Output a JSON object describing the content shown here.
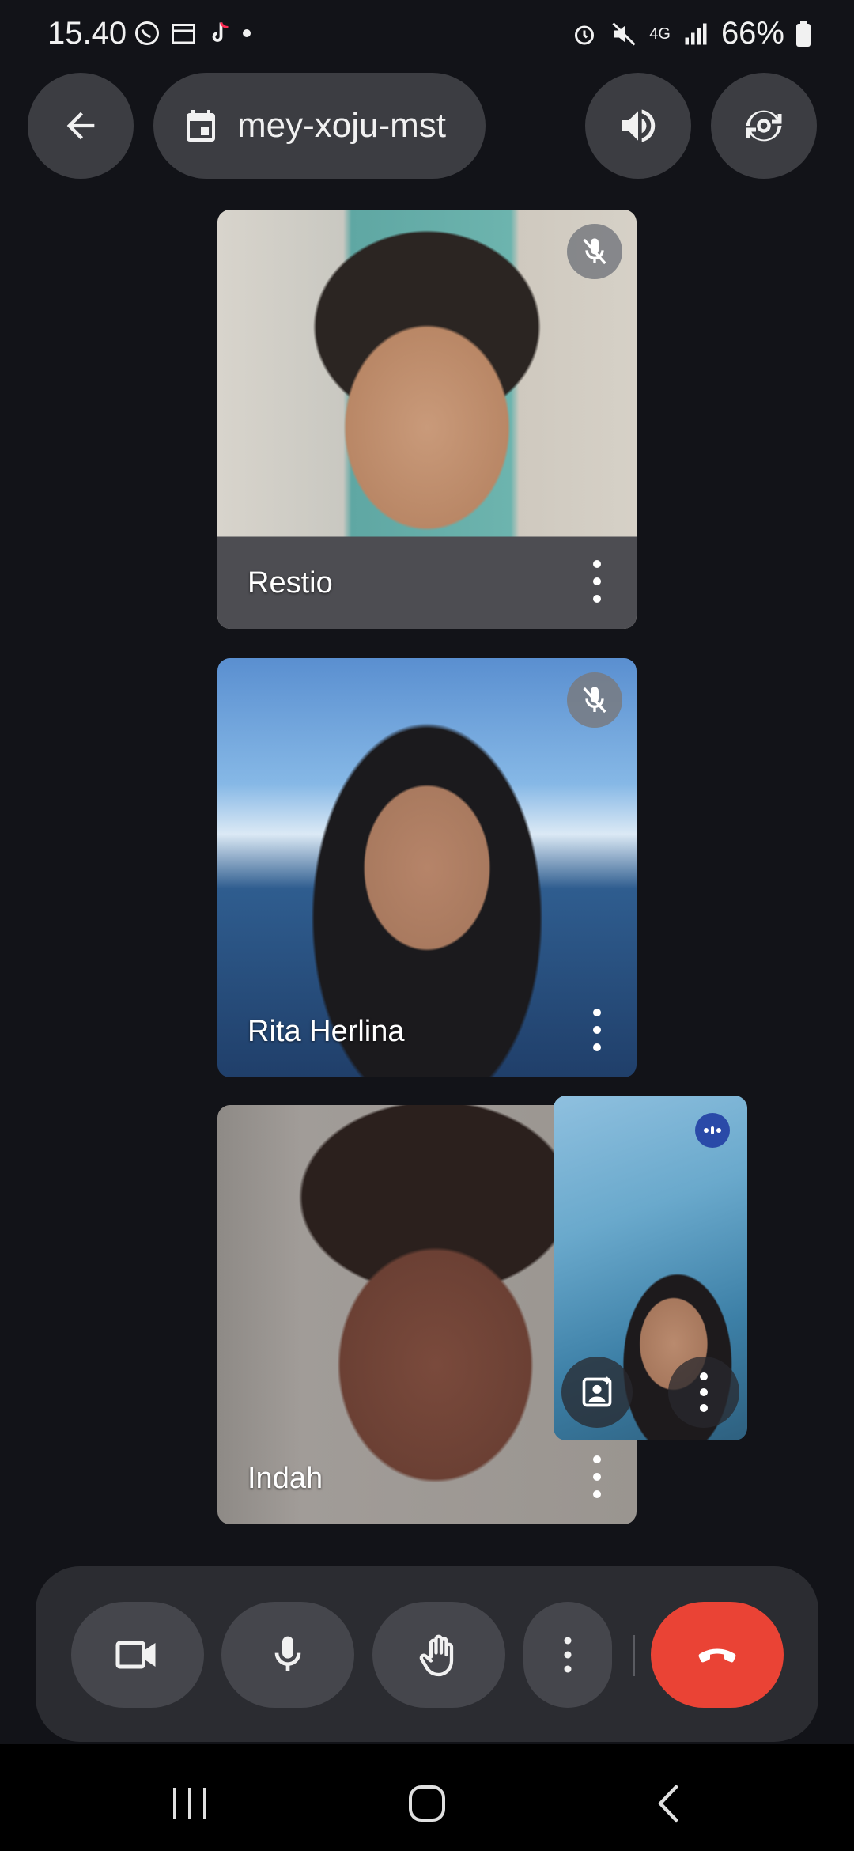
{
  "status_bar": {
    "time": "15.40",
    "network": "4G",
    "battery": "66%"
  },
  "header": {
    "back_icon": "arrow-left-icon",
    "meeting_code": "mey-xoju-mst",
    "calendar_icon": "calendar-icon",
    "speaker_icon": "speaker-icon",
    "switch_camera_icon": "switch-camera-icon"
  },
  "participants": [
    {
      "name": "Restio",
      "muted": true
    },
    {
      "name": "Rita Herlina",
      "muted": true
    },
    {
      "name": "Indah",
      "muted": false
    }
  ],
  "self_view": {
    "audio_indicator": "speaking-dots-icon",
    "effects_icon": "portrait-effects-icon",
    "more_icon": "more-vertical-icon"
  },
  "controls": [
    {
      "name": "camera",
      "icon": "videocam-icon"
    },
    {
      "name": "microphone",
      "icon": "mic-icon"
    },
    {
      "name": "raise-hand",
      "icon": "hand-icon"
    },
    {
      "name": "more-options",
      "icon": "more-vertical-icon"
    },
    {
      "name": "end-call",
      "icon": "call-end-icon"
    }
  ],
  "colors": {
    "background": "#121318",
    "button": "#3c3d42",
    "end_call": "#ea4335",
    "self_badge": "#2a4aa8"
  }
}
